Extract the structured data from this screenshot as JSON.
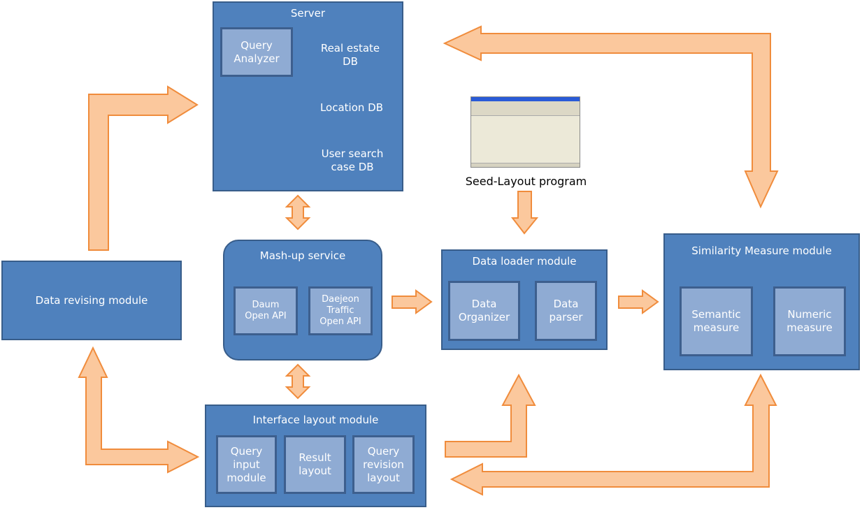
{
  "colors": {
    "module_fill": "#4f81bd",
    "module_border": "#385d8a",
    "inner_fill": "#8fabd3",
    "arrow_fill": "#fbc89d",
    "arrow_stroke": "#f08c3c"
  },
  "server": {
    "title": "Server",
    "query_analyzer": "Query\nAnalyzer",
    "dbs": [
      "Real estate\nDB",
      "Location DB",
      "User search\ncase DB"
    ]
  },
  "mashup": {
    "title": "Mash-up service",
    "items": [
      "Daum\nOpen API",
      "Daejeon\nTraffic\nOpen API"
    ]
  },
  "data_revising": {
    "title": "Data revising module"
  },
  "interface": {
    "title": "Interface layout module",
    "items": [
      "Query\ninput\nmodule",
      "Result\nlayout",
      "Query\nrevision\nlayout"
    ]
  },
  "data_loader": {
    "title": "Data loader module",
    "items": [
      "Data\nOrganizer",
      "Data\nparser"
    ]
  },
  "similarity": {
    "title": "Similarity Measure module",
    "items": [
      "Semantic\nmeasure",
      "Numeric\nmeasure"
    ]
  },
  "seed": {
    "caption": "Seed-Layout program",
    "icon": "program-window-screenshot"
  }
}
